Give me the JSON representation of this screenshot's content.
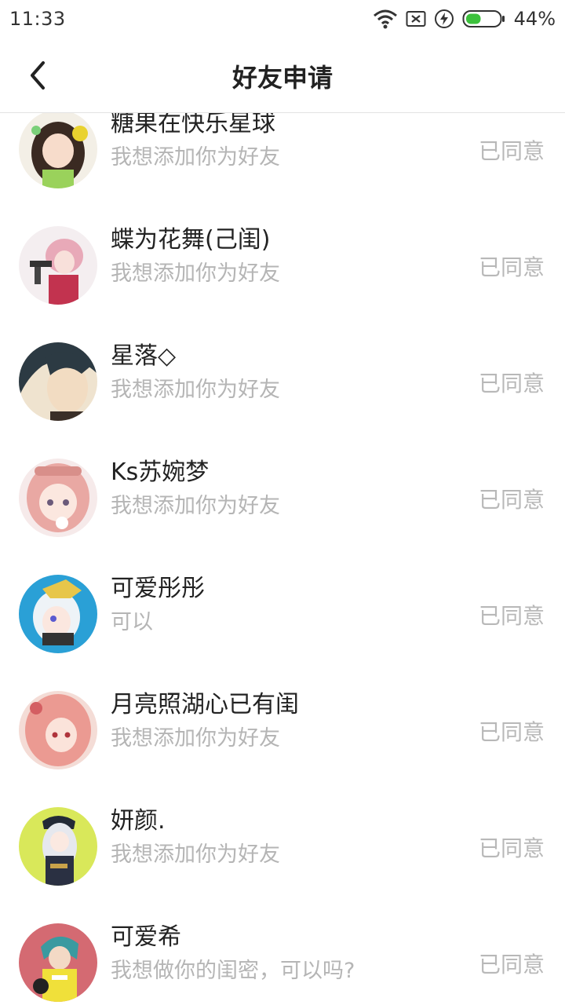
{
  "status_bar": {
    "time": "11:33",
    "battery": "44%",
    "battery_level": 0.44,
    "icons": [
      "wifi-icon",
      "no-sim-icon",
      "charging-icon",
      "battery-icon"
    ]
  },
  "header": {
    "title": "好友申请",
    "back_icon": "chevron-left-icon"
  },
  "colors": {
    "title": "#222222",
    "secondary": "#b5b5b5",
    "divider": "#e2e2e2",
    "battery_fill": "#3cc13c"
  },
  "requests": [
    {
      "name": "糖果在快乐星球",
      "message": "我想添加你为好友",
      "status": "已同意"
    },
    {
      "name": "蝶为花舞(己闺)",
      "message": "我想添加你为好友",
      "status": "已同意"
    },
    {
      "name": "星落◇",
      "message": "我想添加你为好友",
      "status": "已同意"
    },
    {
      "name": "Ks苏婉梦",
      "message": "我想添加你为好友",
      "status": "已同意"
    },
    {
      "name": "可爱彤彤",
      "message": "可以",
      "status": "已同意"
    },
    {
      "name": "月亮照湖心已有闺",
      "message": "我想添加你为好友",
      "status": "已同意"
    },
    {
      "name": "妍颜.",
      "message": "我想添加你为好友",
      "status": "已同意"
    },
    {
      "name": "可爱希",
      "message": "我想做你的闺密，可以吗?",
      "status": "已同意"
    }
  ]
}
